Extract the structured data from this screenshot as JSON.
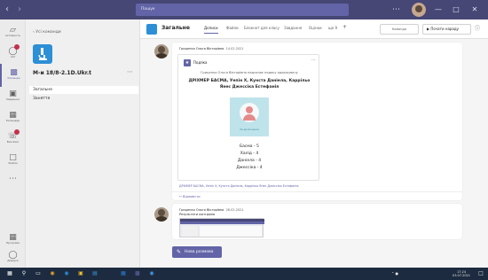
{
  "titlebar": {
    "search_placeholder": "Пошук",
    "colors": {
      "bg": "#464775",
      "accent": "#6264a7"
    }
  },
  "rail": {
    "items": [
      {
        "label": "Активність",
        "icon": "bell-icon"
      },
      {
        "label": "Чат",
        "icon": "chat-icon"
      },
      {
        "label": "Команди",
        "icon": "teams-icon"
      },
      {
        "label": "Завдання",
        "icon": "assignments-icon"
      },
      {
        "label": "Календар",
        "icon": "calendar-icon"
      },
      {
        "label": "Виклики",
        "icon": "calls-icon"
      },
      {
        "label": "Файли",
        "icon": "files-icon"
      },
      {
        "label": "Програми",
        "icon": "apps-icon"
      },
      {
        "label": "Довідка",
        "icon": "help-icon"
      }
    ]
  },
  "sidebar": {
    "back_label": "Усі команди",
    "team_name": "М-и 18/8-2.1D.Ukr.t",
    "channels": [
      "Загальне",
      "Заняття"
    ]
  },
  "channel": {
    "title": "Загальне",
    "tabs": [
      "Дописи",
      "Файли",
      "Блокнот для класу",
      "Завдання",
      "Оцінки",
      "ще 9"
    ],
    "team_label": "Команда",
    "meet_label": "Почати нараду"
  },
  "message1": {
    "author": "Гриценко Ольга Вікторівна",
    "time": "14.02.2021",
    "app": "Подяка",
    "intro": "Гриценко Ольга Вікторівна надсилає подяку одержувачу",
    "names": "ДРІХМЕР БАСМА, Уепін Х, Кунста Даніела, Каррільо Янес Джессіка Естефанія",
    "image_caption": "За досягнення",
    "grades": [
      "Басма - 5",
      "Халід - 4",
      "Даніела - 4",
      "Джессіка - 4"
    ],
    "recipients_line": "ДРІХМЕР БАСМА, Уепін Х, Кунста Даніела, Каррільо Янес Джессіка Естефанія",
    "reply_label": "Відповісти"
  },
  "message2": {
    "author": "Гриценко Ольга Вікторівна",
    "time": "28.02.2021",
    "text": "Результати контролю"
  },
  "new_conversation": "Нова розмова",
  "taskbar": {
    "time": "17:24",
    "date": "03.07.2021"
  }
}
